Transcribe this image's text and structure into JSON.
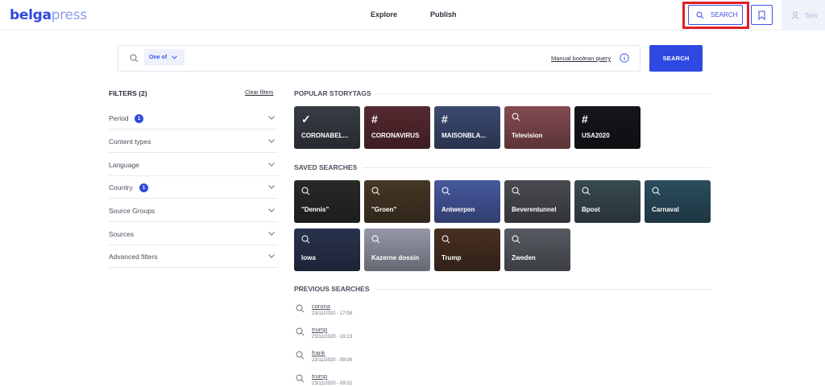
{
  "header": {
    "logo_bold": "belga",
    "logo_light": "press",
    "nav": [
      "Explore",
      "Publish"
    ],
    "search_label": "SEARCH",
    "user_name": "Tom"
  },
  "searchbar": {
    "operator": "One of",
    "manual_link": "Manual boolean query",
    "button": "SEARCH"
  },
  "filters": {
    "title": "FILTERS (2)",
    "clear": "Clear filters",
    "items": [
      {
        "label": "Period",
        "badge": "1"
      },
      {
        "label": "Content types",
        "badge": null
      },
      {
        "label": "Language",
        "badge": null
      },
      {
        "label": "Country",
        "badge": "1"
      },
      {
        "label": "Source Groups",
        "badge": null
      },
      {
        "label": "Sources",
        "badge": null
      },
      {
        "label": "Advanced filters",
        "badge": null
      }
    ]
  },
  "popular": {
    "title": "POPULAR STORYTAGS",
    "tiles": [
      {
        "icon": "check-icon",
        "label": "CORONABEL...",
        "color": "#3b4048"
      },
      {
        "icon": "hash-icon",
        "label": "CORONAVIRUS",
        "color": "#5b2c33"
      },
      {
        "icon": "hash-icon",
        "label": "MAISONBLA...",
        "color": "#3f4e77"
      },
      {
        "icon": "search-icon",
        "label": "Television",
        "color": "#8a4f55"
      },
      {
        "icon": "hash-icon",
        "label": "USA2020",
        "color": "#15171b"
      }
    ]
  },
  "saved": {
    "title": "SAVED SEARCHES",
    "tiles": [
      {
        "label": "\"Dennis\"",
        "color": "#2a2c2a"
      },
      {
        "label": "\"Groen\"",
        "color": "#4a3a28"
      },
      {
        "label": "Antwerpen",
        "color": "#4b5ea8"
      },
      {
        "label": "Beverentunnel",
        "color": "#4d4f55"
      },
      {
        "label": "Bpost",
        "color": "#3c4e56"
      },
      {
        "label": "Carnaval",
        "color": "#2d5163"
      },
      {
        "label": "Iowa",
        "color": "#2c3652"
      },
      {
        "label": "Kazerne dossin",
        "color": "#9c9fb1"
      },
      {
        "label": "Trump",
        "color": "#4b3223"
      },
      {
        "label": "Zweden",
        "color": "#5b5f66"
      }
    ]
  },
  "previous": {
    "title": "PREVIOUS SEARCHES",
    "items": [
      {
        "query": "corona",
        "date": "23/11/2020 - 17:08"
      },
      {
        "query": "trump",
        "date": "23/11/2020 - 16:13"
      },
      {
        "query": "frank",
        "date": "23/11/2020 - 09:06"
      },
      {
        "query": "trump",
        "date": "23/11/2020 - 09:02"
      }
    ]
  }
}
